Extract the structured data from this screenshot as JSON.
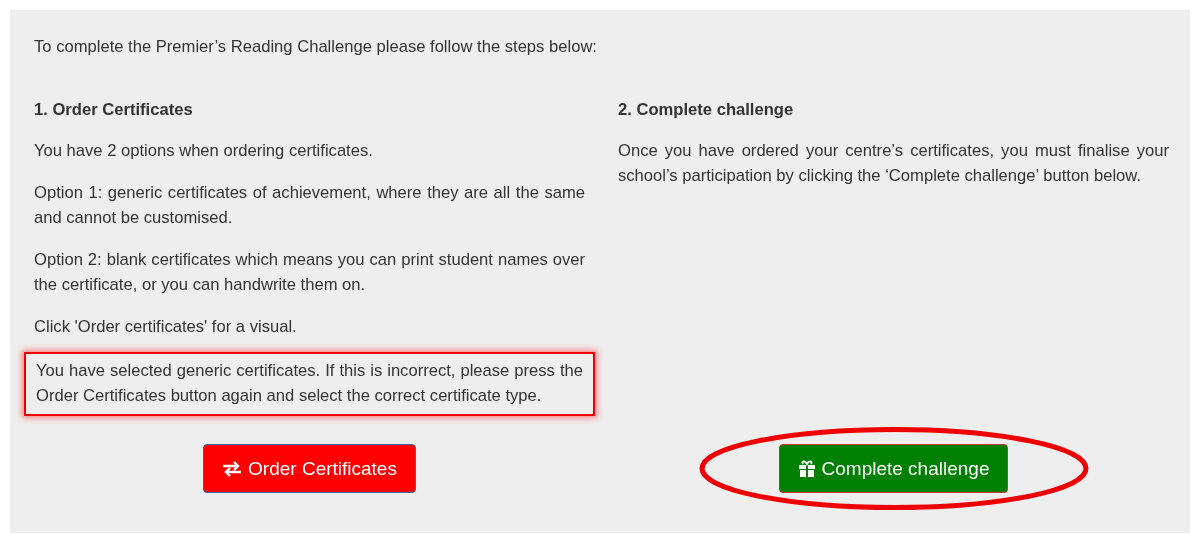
{
  "intro": "To complete the Premier’s Reading Challenge please follow the steps below:",
  "columns": [
    {
      "heading": "1. Order Certificates",
      "paragraphs": [
        "You have 2 options when ordering certificates.",
        "Option 1: generic certificates of achievement, where they are all the same and cannot be customised.",
        "Option 2: blank certificates which means you can print student names over the certificate, or you can handwrite them on.",
        "Click 'Order certificates' for a visual."
      ],
      "notice": {
        "text": "You have selected generic certificates. If this is incorrect, please press the Order Certificates button again and select the correct certificate type.",
        "highlighted": true
      },
      "button": {
        "kind": "order",
        "label": "Order Certificates",
        "highlighted": false
      }
    },
    {
      "heading": "2. Complete challenge",
      "paragraphs": [
        "Once you have ordered your centre’s certificates, you must finalise your school’s participation by clicking the ‘Complete challenge’ button below."
      ],
      "button": {
        "kind": "complete",
        "label": "Complete challenge",
        "highlighted": true
      }
    }
  ]
}
